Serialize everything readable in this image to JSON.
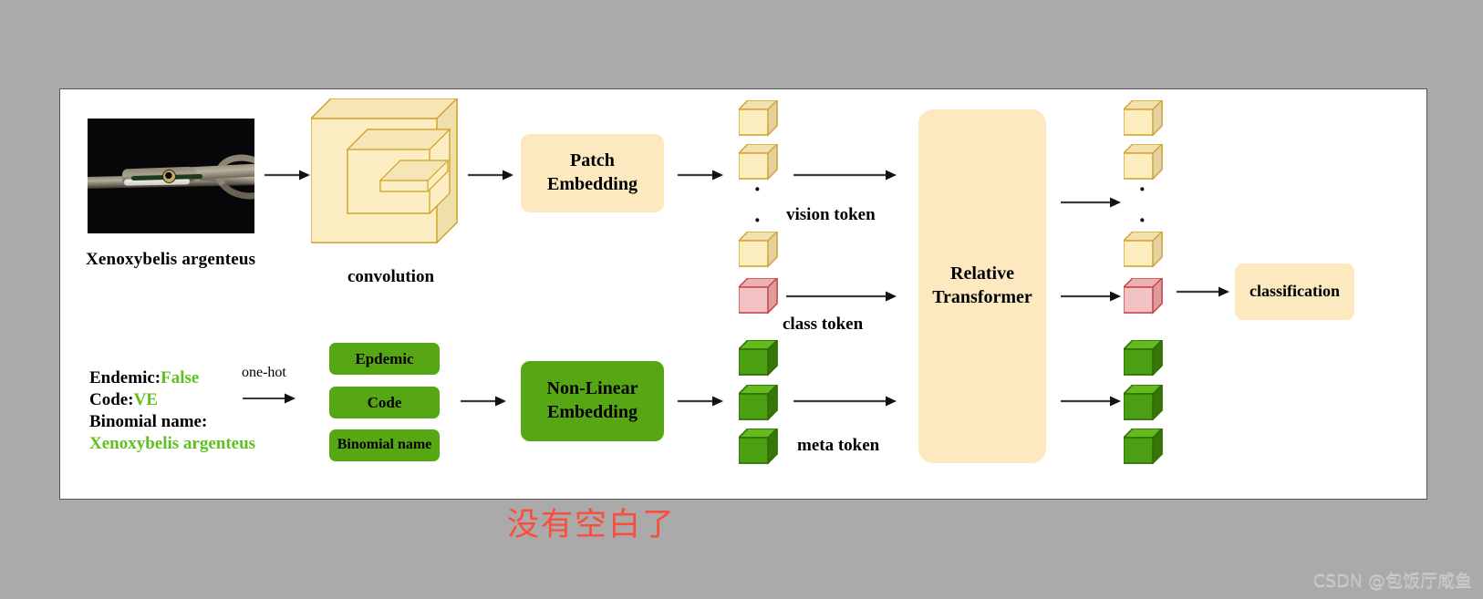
{
  "figure": {
    "input_caption": "Xenoxybelis argenteus",
    "convolution_label": "convolution",
    "patch_embedding_label": "Patch\nEmbedding",
    "patch_embedding_line1": "Patch",
    "patch_embedding_line2": "Embedding",
    "nonlinear_embedding_line1": "Non-Linear",
    "nonlinear_embedding_line2": "Embedding",
    "transformer_line1": "Relative",
    "transformer_line2": "Transformer",
    "classification_label": "classification",
    "one_hot_label": "one-hot",
    "vision_token_label": "vision token",
    "class_token_label": "class token",
    "meta_token_label": "meta token",
    "vertical_dots": "·"
  },
  "metadata": {
    "endemic_key": "Endemic:",
    "endemic_value": "False",
    "code_key": "Code:",
    "code_value": "VE",
    "binomial_key": "Binomial name:",
    "binomial_value": "Xenoxybelis argenteus"
  },
  "meta_boxes": [
    {
      "label": "Epdemic"
    },
    {
      "label": "Code"
    },
    {
      "label": "Binomial name"
    }
  ],
  "annotations": {
    "red_note": "没有空白了",
    "watermark": "CSDN @包饭厅咸鱼"
  },
  "colors": {
    "background": "#aaaaaa",
    "panel": "#ffffff",
    "cream_box": "#fde9bf",
    "green_box": "#57a715",
    "cube_yellow_front": "#fdeec0",
    "cube_yellow_top": "#f2e0b0",
    "cube_yellow_side": "#e4d0a0",
    "cube_yellow_stroke": "#d2a731",
    "cube_pink_front": "#f3c3c4",
    "cube_pink_top": "#ecb0b2",
    "cube_pink_side": "#df9a9c",
    "cube_pink_stroke": "#c2484c",
    "cube_green_front": "#4aa011",
    "cube_green_top": "#63bb1e",
    "cube_green_side": "#347607",
    "cube_green_stroke": "#2f6a06",
    "conv_fill": "#fcedc2",
    "conv_side": "#efdda9",
    "conv_stroke": "#cfa52c",
    "accent_green_text": "#5ebf20",
    "red_note": "#fb4d3d",
    "arrow": "#4a4a4a"
  }
}
